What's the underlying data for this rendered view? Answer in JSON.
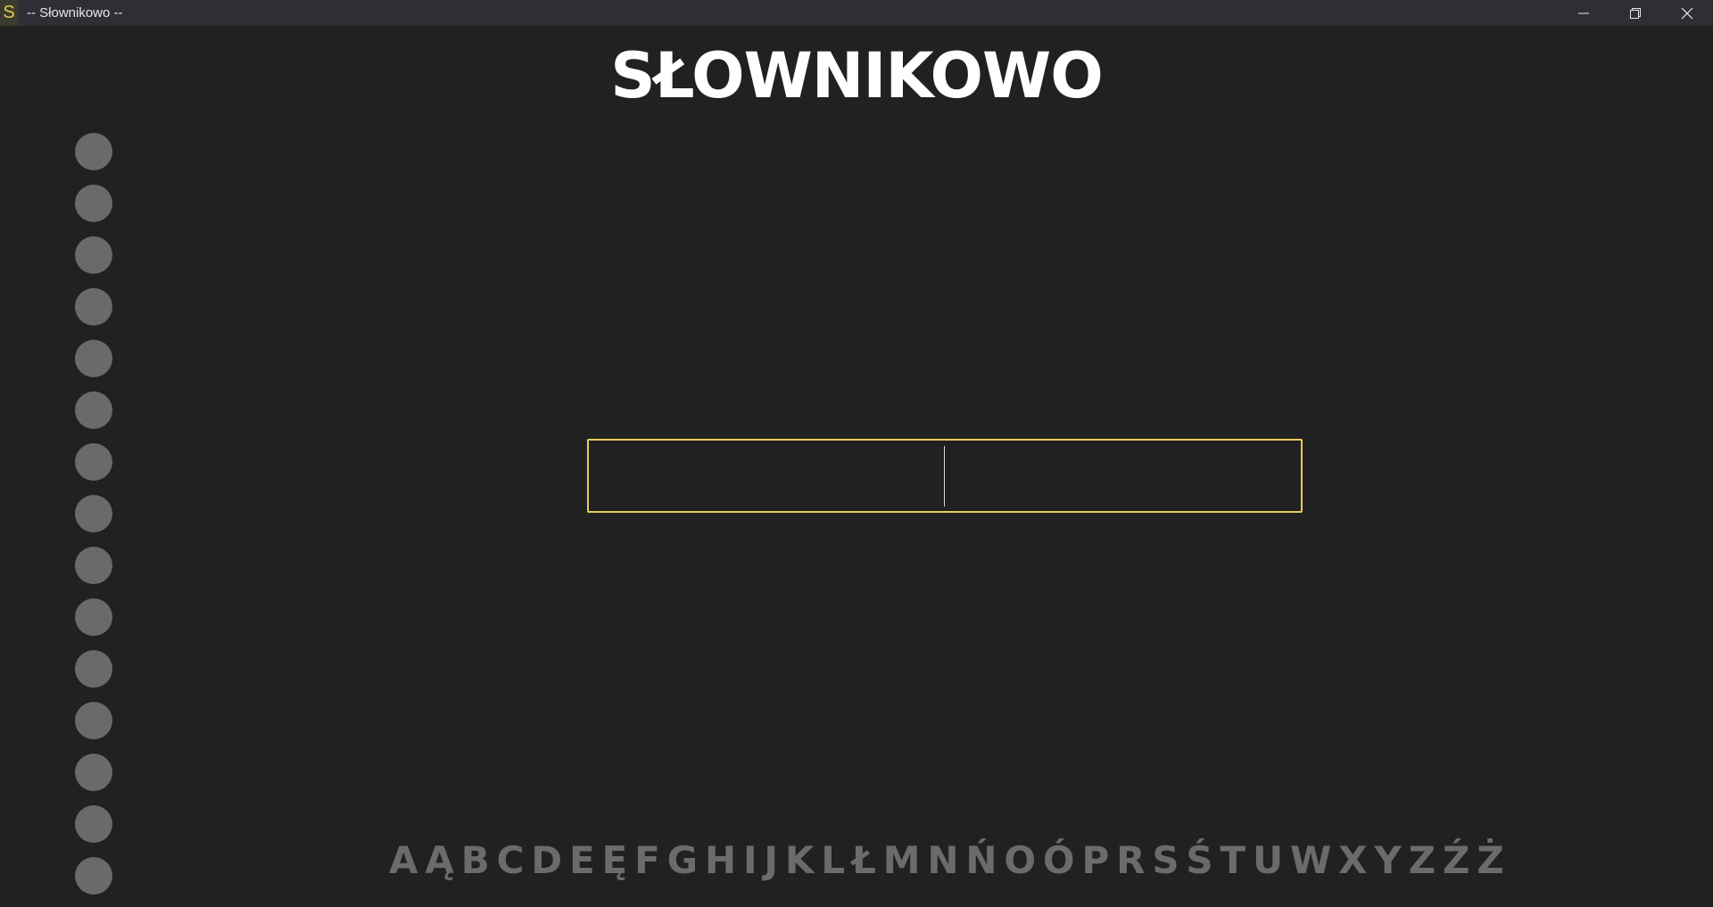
{
  "window": {
    "app_icon_letter": "S",
    "title": "-- Słownikowo --"
  },
  "app": {
    "title": "SŁOWNIKOWO"
  },
  "search": {
    "value": "",
    "placeholder": ""
  },
  "side_dots_count": 15,
  "alphabet": [
    "A",
    "Ą",
    "B",
    "C",
    "D",
    "E",
    "Ę",
    "F",
    "G",
    "H",
    "I",
    "J",
    "K",
    "L",
    "Ł",
    "M",
    "N",
    "Ń",
    "O",
    "Ó",
    "P",
    "R",
    "S",
    "Ś",
    "T",
    "U",
    "W",
    "X",
    "Y",
    "Z",
    "Ź",
    "Ż"
  ],
  "colors": {
    "background": "#212121",
    "titlebar": "#2e2f34",
    "accent": "#e8cc5c",
    "dot": "#6a6a6a",
    "letter": "#6b6b6b"
  }
}
